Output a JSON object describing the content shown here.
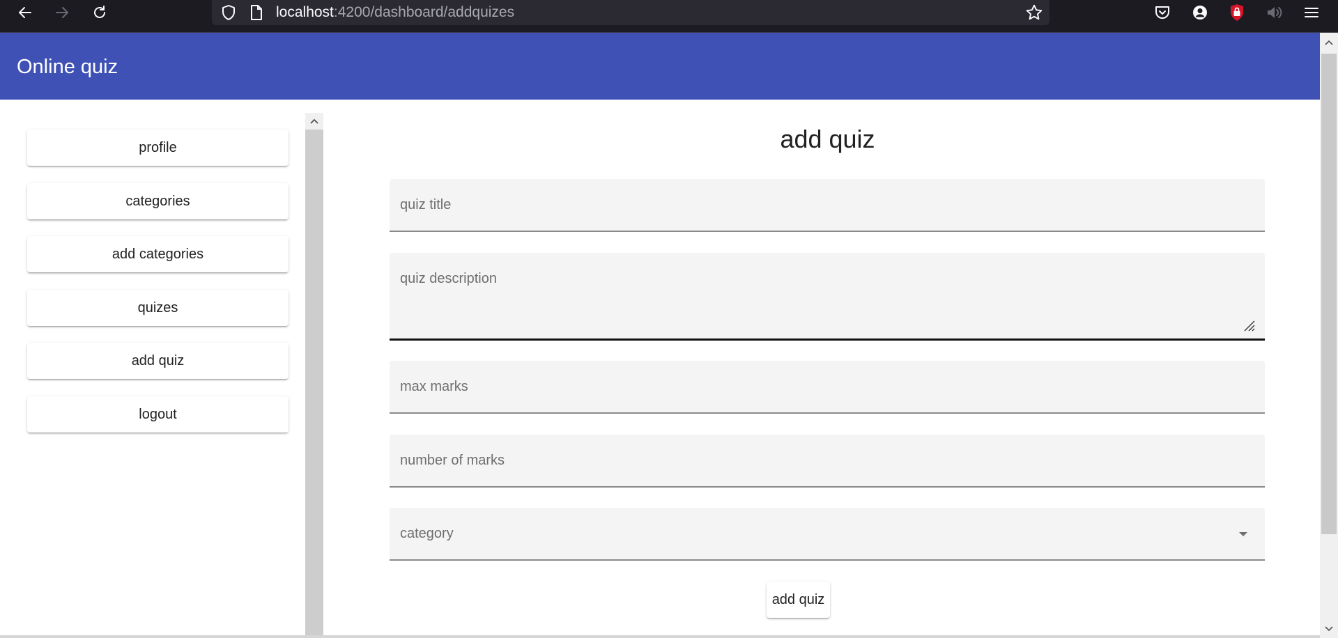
{
  "browser": {
    "url_host": "localhost",
    "url_path": ":4200/dashboard/addquizes",
    "icons": [
      "back-arrow-icon",
      "forward-arrow-icon",
      "reload-icon",
      "shield-icon",
      "page-icon",
      "bookmark-star-icon",
      "pocket-icon",
      "account-icon",
      "ublock-icon",
      "speaker-icon",
      "menu-icon"
    ]
  },
  "app": {
    "title": "Online quiz",
    "colors": {
      "toolbar": "#3f51b5",
      "background": "#ffffff",
      "field": "#f4f4f4"
    }
  },
  "sidebar": {
    "items": [
      {
        "label": "profile"
      },
      {
        "label": "categories"
      },
      {
        "label": "add categories"
      },
      {
        "label": "quizes"
      },
      {
        "label": "add quiz"
      },
      {
        "label": "logout"
      }
    ]
  },
  "form": {
    "title": "add quiz",
    "fields": {
      "quiz_title": {
        "placeholder": "quiz title",
        "value": ""
      },
      "quiz_description": {
        "placeholder": "quiz description",
        "value": ""
      },
      "max_marks": {
        "placeholder": "max marks",
        "value": ""
      },
      "number_of_marks": {
        "placeholder": "number of marks",
        "value": ""
      },
      "category": {
        "placeholder": "category",
        "value": ""
      }
    },
    "submit_label": "add quiz"
  }
}
